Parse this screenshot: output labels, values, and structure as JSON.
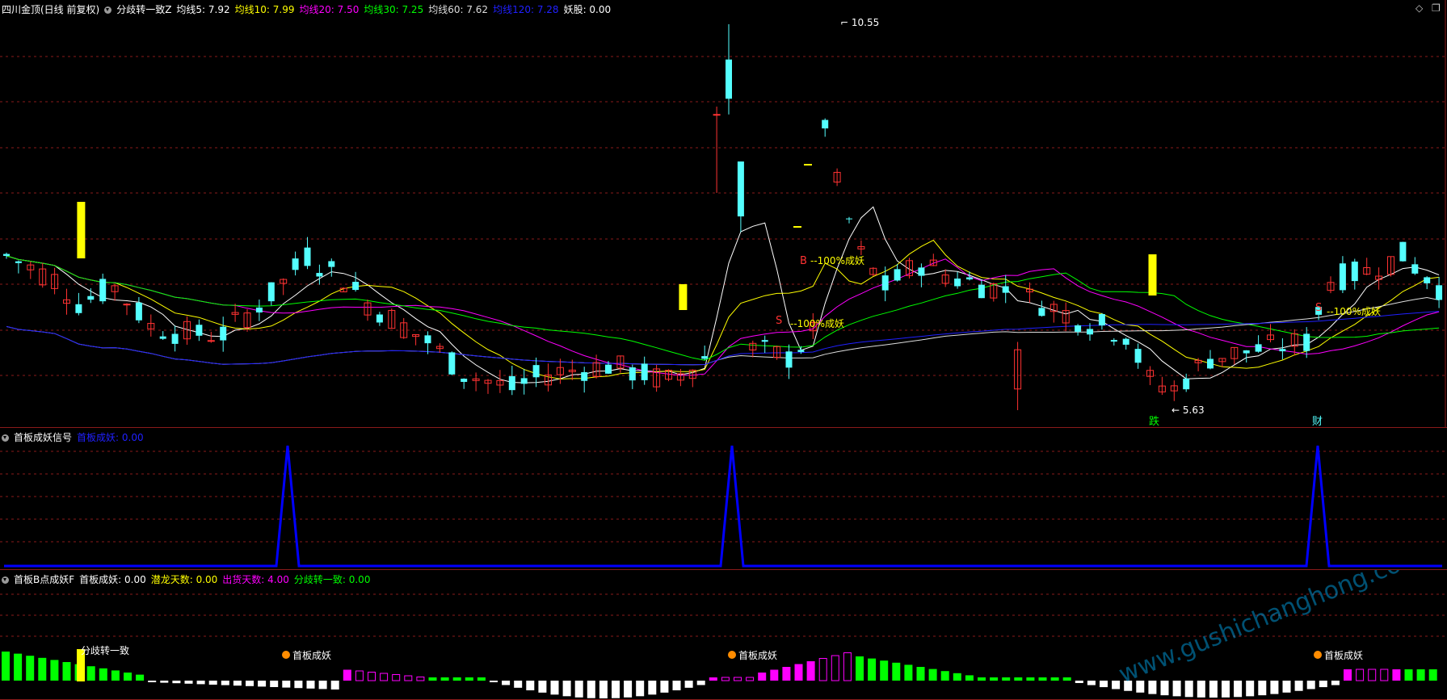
{
  "main": {
    "title": "四川金顶(日线 前复权)",
    "indicator": "分歧转一致Z",
    "ma": [
      {
        "label": "均线5: 7.92",
        "color": "#ffffff"
      },
      {
        "label": "均线10: 7.99",
        "color": "#ffff00"
      },
      {
        "label": "均线20: 7.50",
        "color": "#ff00ff"
      },
      {
        "label": "均线30: 7.25",
        "color": "#00ff00"
      },
      {
        "label": "均线60: 7.62",
        "color": "#dddddd"
      },
      {
        "label": "均线120: 7.28",
        "color": "#2020ff"
      },
      {
        "label": "妖股: 0.00",
        "color": "#ffffff"
      }
    ],
    "high_label": "10.55",
    "low_label": "5.63",
    "annot_100": "100%成妖",
    "annot_b": "B",
    "annot_s": "S",
    "annot_die": "跌",
    "annot_cai": "财"
  },
  "sub1": {
    "title": "首板成妖信号",
    "value": "首板成妖: 0.00"
  },
  "sub2": {
    "title": "首板B点成妖F",
    "values": [
      {
        "label": "首板成妖: 0.00",
        "color": "#ffffff"
      },
      {
        "label": "潜龙天数: 0.00",
        "color": "#ffff00"
      },
      {
        "label": "出货天数: 4.00",
        "color": "#ff00ff"
      },
      {
        "label": "分歧转一致: 0.00",
        "color": "#00ff00"
      }
    ],
    "annot_fenqi": "分歧转一致",
    "annot_shouban": "首板成妖"
  },
  "watermark": "www.gushichanghong.com",
  "colors": {
    "up": "#ff3232",
    "down": "#54ffff",
    "grid": "#8a1a1a",
    "signal": "#0000ff",
    "yellow": "#ffff00"
  }
}
